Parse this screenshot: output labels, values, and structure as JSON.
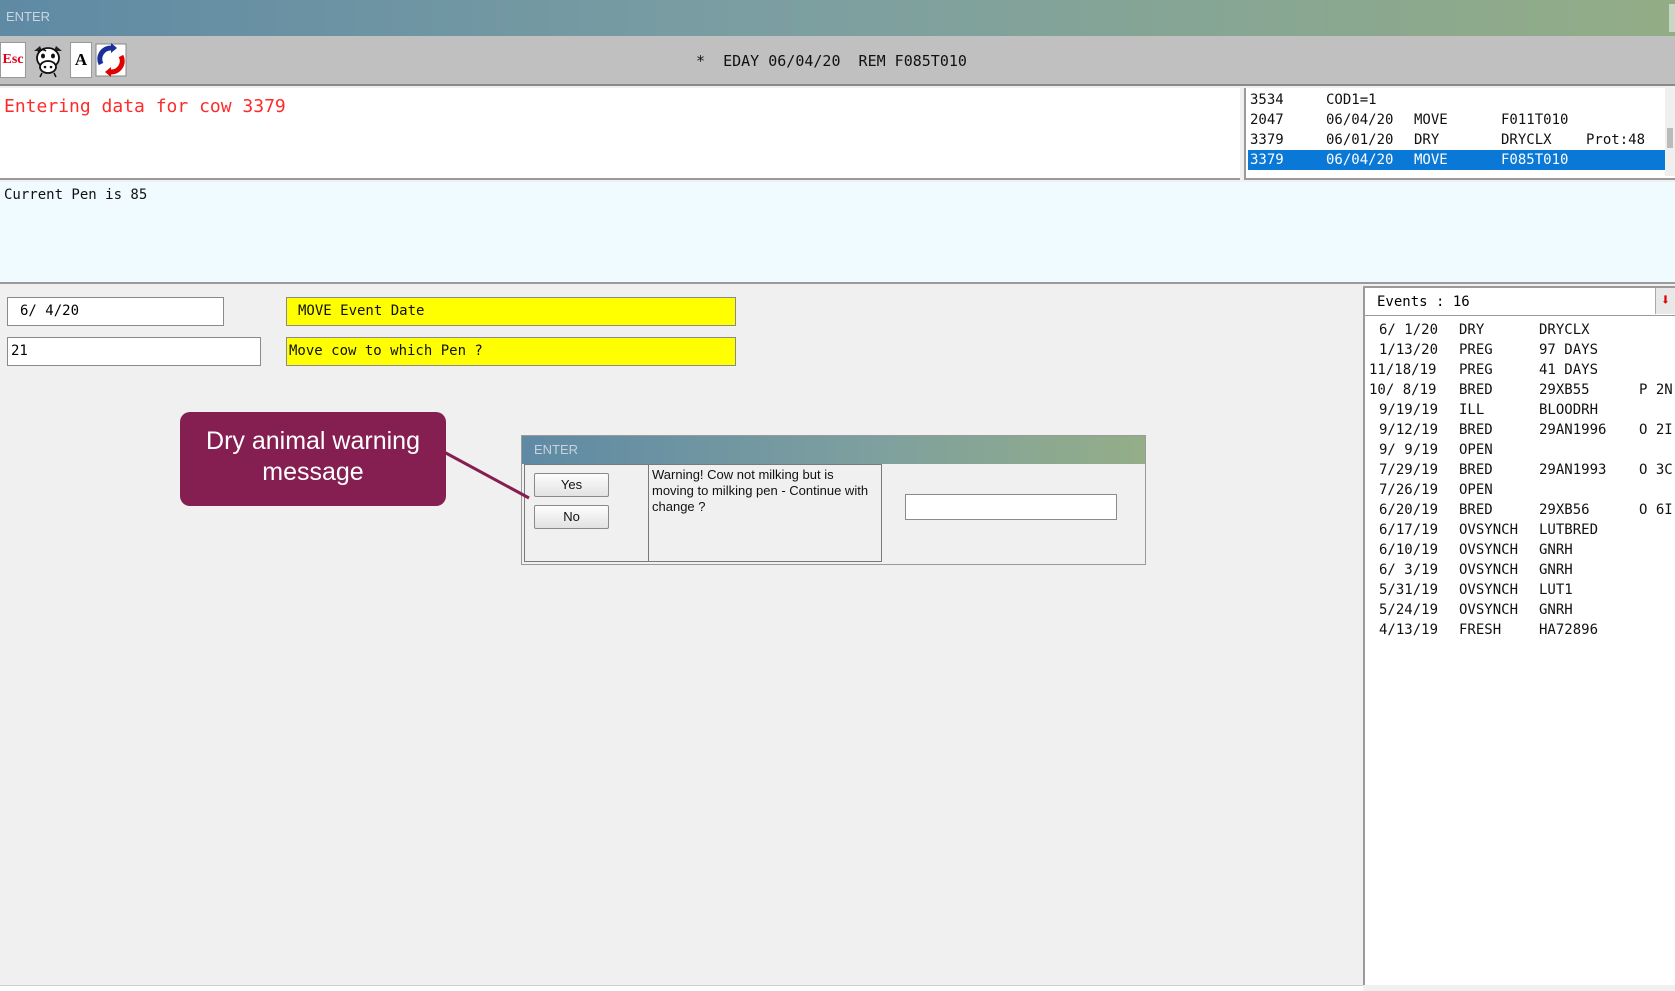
{
  "window": {
    "title": "ENTER"
  },
  "toolbar": {
    "esc_label": "Esc",
    "a_label": "A",
    "status": "*  EDAY 06/04/20  REM F085T010"
  },
  "message": {
    "text": "Entering data for cow 3379"
  },
  "recent": [
    {
      "id": "3534",
      "date": "COD1=1",
      "event": "",
      "code": "",
      "extra": ""
    },
    {
      "id": "2047",
      "date": "06/04/20",
      "event": "MOVE",
      "code": "F011T010",
      "extra": ""
    },
    {
      "id": "3379",
      "date": "06/01/20",
      "event": "DRY",
      "code": "DRYCLX",
      "extra": "Prot:48"
    },
    {
      "id": "3379",
      "date": "06/04/20",
      "event": "MOVE",
      "code": "F085T010",
      "extra": ""
    }
  ],
  "pen_info": "Current Pen is 85",
  "entries": {
    "date_value": "6/ 4/20",
    "date_prompt": "MOVE Event Date",
    "pen_value": "21",
    "pen_prompt": "Move cow to which Pen ?"
  },
  "events": {
    "header": "Events : 16",
    "rows": [
      {
        "date": "6/ 1/20",
        "event": "DRY",
        "remark": "DRYCLX",
        "extra": ""
      },
      {
        "date": "1/13/20",
        "event": "PREG",
        "remark": "97 DAYS",
        "extra": ""
      },
      {
        "date": "11/18/19",
        "event": "PREG",
        "remark": "41 DAYS",
        "extra": ""
      },
      {
        "date": "10/ 8/19",
        "event": "BRED",
        "remark": "29XB55",
        "extra": "P 2N"
      },
      {
        "date": "9/19/19",
        "event": "ILL",
        "remark": "BLOODRH",
        "extra": ""
      },
      {
        "date": "9/12/19",
        "event": "BRED",
        "remark": "29AN1996",
        "extra": "O 2I"
      },
      {
        "date": "9/ 9/19",
        "event": "OPEN",
        "remark": "",
        "extra": ""
      },
      {
        "date": "7/29/19",
        "event": "BRED",
        "remark": "29AN1993",
        "extra": "O 3C"
      },
      {
        "date": "7/26/19",
        "event": "OPEN",
        "remark": "",
        "extra": ""
      },
      {
        "date": "6/20/19",
        "event": "BRED",
        "remark": "29XB56",
        "extra": "O 6I"
      },
      {
        "date": "6/17/19",
        "event": "OVSYNCH",
        "remark": "LUTBRED",
        "extra": ""
      },
      {
        "date": "6/10/19",
        "event": "OVSYNCH",
        "remark": "GNRH",
        "extra": ""
      },
      {
        "date": "6/ 3/19",
        "event": "OVSYNCH",
        "remark": "GNRH",
        "extra": ""
      },
      {
        "date": "5/31/19",
        "event": "OVSYNCH",
        "remark": "LUT1",
        "extra": ""
      },
      {
        "date": "5/24/19",
        "event": "OVSYNCH",
        "remark": "GNRH",
        "extra": ""
      },
      {
        "date": "4/13/19",
        "event": "FRESH",
        "remark": "HA72896",
        "extra": ""
      }
    ]
  },
  "dialog": {
    "title": "ENTER",
    "yes_label": "Yes",
    "no_label": "No",
    "message": "Warning!  Cow not milking  but is moving to milking pen -  Continue with change ?",
    "input_value": ""
  },
  "callout": {
    "text": "Dry animal warning message"
  },
  "colors": {
    "message_text": "#ff2a2a",
    "selection": "#0a78d7",
    "prompt_bg": "#ffff00",
    "callout_bg": "#861f51"
  },
  "icons": [
    "cow-icon",
    "sync-icon",
    "scroll-down-arrow-icon"
  ]
}
